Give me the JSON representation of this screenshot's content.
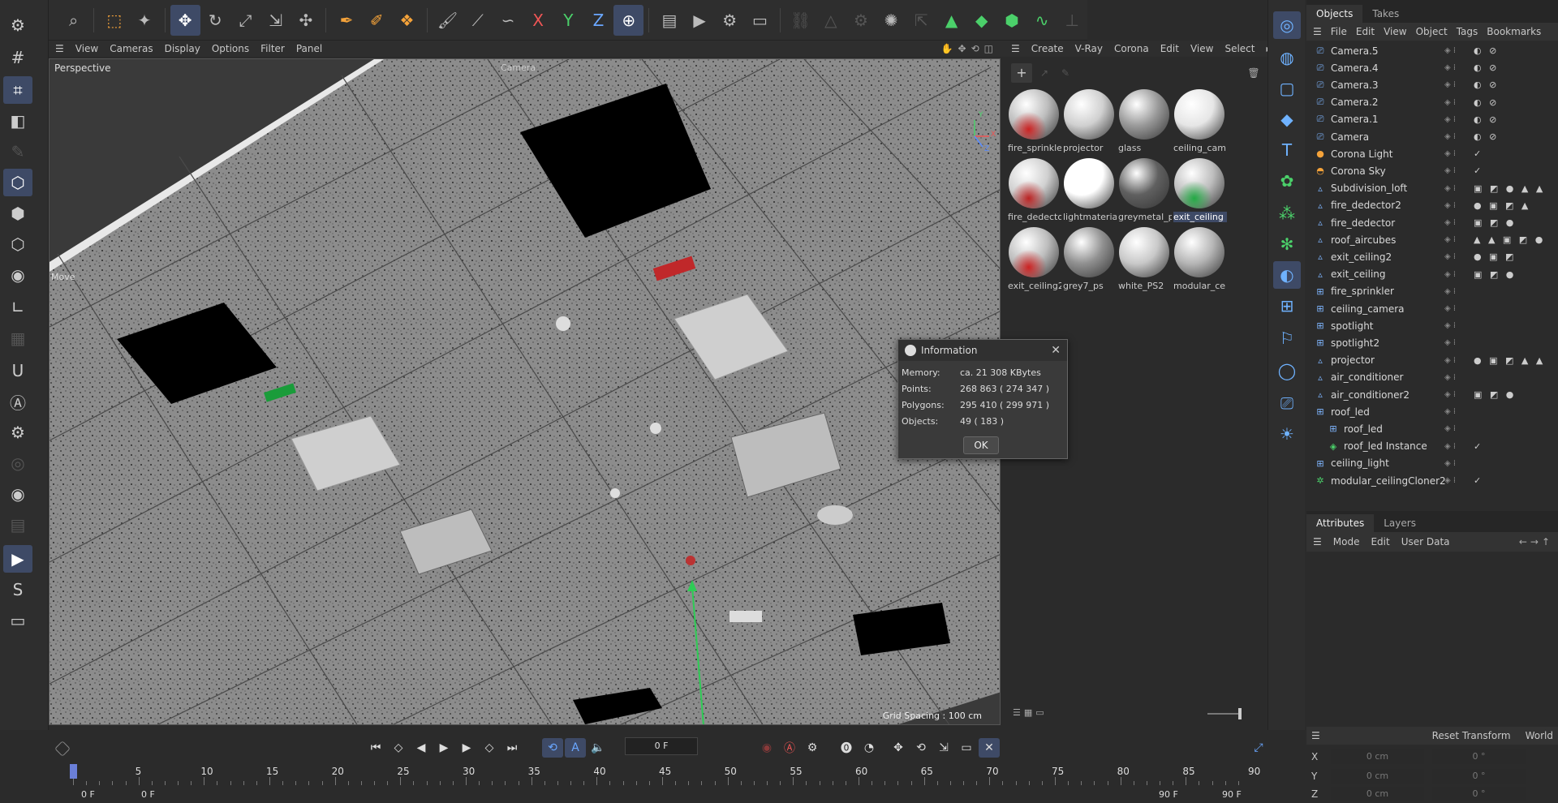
{
  "top_toolbar": {
    "icons": [
      "search-icon",
      "select-icon",
      "live-select-icon",
      "move-icon",
      "rotate-icon",
      "scale-icon",
      "transform-icon",
      "snap-icon",
      "spline-pen-icon",
      "spline-sketch-icon",
      "spline-nodes-icon",
      "brush-icon",
      "knife-icon",
      "magnet-icon",
      "x-axis-icon",
      "y-axis-icon",
      "z-axis-icon",
      "coordinate-system-icon",
      "render-view-icon",
      "render-picture-viewer-icon",
      "edit-render-settings-icon",
      "render-queue-icon",
      "link-icon",
      "triangle-icon",
      "gear-icon",
      "particles-icon",
      "transfer-icon",
      "pyramid-icon",
      "cube-green-icon",
      "cube-icon",
      "deformer-icon",
      "axis-icon"
    ],
    "axis_labels": {
      "x": "X",
      "y": "Y",
      "z": "Z"
    }
  },
  "viewport": {
    "menu": [
      "View",
      "Cameras",
      "Display",
      "Options",
      "Filter",
      "Panel"
    ],
    "label": "Perspective",
    "camera_label": "Camera",
    "grid_spacing": "Grid Spacing : 100 cm",
    "hud_move": "Move",
    "axis": {
      "x": "X",
      "y": "Y",
      "z": "Z"
    }
  },
  "materials": {
    "menu": [
      "Create",
      "V-Ray",
      "Corona",
      "Edit",
      "View",
      "Select"
    ],
    "items": [
      {
        "name": "fire_sprinkle",
        "color": "#bdbdbd",
        "accent": "#cc2222"
      },
      {
        "name": "projector",
        "color": "#d0d0d0",
        "accent": ""
      },
      {
        "name": "glass",
        "color": "#9a9a9a",
        "accent": ""
      },
      {
        "name": "ceiling_cam",
        "color": "#e6e6e6",
        "accent": ""
      },
      {
        "name": "fire_dedecto",
        "color": "#d0d0d0",
        "accent": "#bb2222"
      },
      {
        "name": "lightmateria",
        "color": "#ffffff",
        "accent": ""
      },
      {
        "name": "greymetal_p",
        "color": "#606060",
        "accent": ""
      },
      {
        "name": "exit_ceiling",
        "color": "#bdbdbd",
        "accent": "#22aa44"
      },
      {
        "name": "exit_ceiling2",
        "color": "#bdbdbd",
        "accent": "#cc2222"
      },
      {
        "name": "grey7_ps",
        "color": "#909090",
        "accent": ""
      },
      {
        "name": "white_PS2",
        "color": "#c8c8c8",
        "accent": ""
      },
      {
        "name": "modular_ce",
        "color": "#b5b5b5",
        "accent": ""
      }
    ],
    "selected": "exit_ceiling"
  },
  "objects_panel": {
    "tabs": [
      "Objects",
      "Takes"
    ],
    "menu": [
      "File",
      "Edit",
      "View",
      "Object",
      "Tags",
      "Bookmarks"
    ],
    "rows": [
      {
        "name": "Camera.5",
        "icon": "camera-icon",
        "tags": "◐ ⊘",
        "indent": 0
      },
      {
        "name": "Camera.4",
        "icon": "camera-icon",
        "tags": "◐ ⊘",
        "indent": 0
      },
      {
        "name": "Camera.3",
        "icon": "camera-icon",
        "tags": "◐ ⊘",
        "indent": 0
      },
      {
        "name": "Camera.2",
        "icon": "camera-icon",
        "tags": "◐ ⊘",
        "indent": 0
      },
      {
        "name": "Camera.1",
        "icon": "camera-icon",
        "tags": "◐ ⊘",
        "indent": 0
      },
      {
        "name": "Camera",
        "icon": "camera-icon",
        "tags": "◐ ⊘",
        "indent": 0
      },
      {
        "name": "Corona Light",
        "icon": "light-icon",
        "tags": "✓",
        "indent": 0
      },
      {
        "name": "Corona Sky",
        "icon": "sky-icon",
        "tags": "✓",
        "indent": 0
      },
      {
        "name": "Subdivision_loft",
        "icon": "polygon-icon",
        "tags": "▣ ◩ ● ▲ ▲",
        "indent": 0
      },
      {
        "name": "fire_dedector2",
        "icon": "polygon-icon",
        "tags": "● ▣ ◩ ▲",
        "indent": 0
      },
      {
        "name": "fire_dedector",
        "icon": "polygon-icon",
        "tags": "▣ ◩ ●",
        "indent": 0
      },
      {
        "name": "roof_aircubes",
        "icon": "polygon-icon",
        "tags": "▲ ▲ ▣ ◩ ●",
        "indent": 0
      },
      {
        "name": "exit_ceiling2",
        "icon": "polygon-icon",
        "tags": "● ▣ ◩",
        "indent": 0
      },
      {
        "name": "exit_ceiling",
        "icon": "polygon-icon",
        "tags": "▣ ◩ ●",
        "indent": 0
      },
      {
        "name": "fire_sprinkler",
        "icon": "null-icon",
        "tags": "",
        "indent": 0
      },
      {
        "name": "ceiling_camera",
        "icon": "null-icon",
        "tags": "",
        "indent": 0
      },
      {
        "name": "spotlight",
        "icon": "null-icon",
        "tags": "",
        "indent": 0
      },
      {
        "name": "spotlight2",
        "icon": "null-icon",
        "tags": "",
        "indent": 0
      },
      {
        "name": "projector",
        "icon": "polygon-icon",
        "tags": "● ▣ ◩ ▲ ▲",
        "indent": 0
      },
      {
        "name": "air_conditioner",
        "icon": "polygon-icon",
        "tags": "",
        "indent": 0
      },
      {
        "name": "air_conditioner2",
        "icon": "polygon-icon",
        "tags": "▣ ◩ ●",
        "indent": 0
      },
      {
        "name": "roof_led",
        "icon": "null-icon",
        "tags": "",
        "indent": 0
      },
      {
        "name": "roof_led",
        "icon": "null-icon",
        "tags": "",
        "indent": 1
      },
      {
        "name": "roof_led Instance",
        "icon": "instance-icon",
        "tags": "✓",
        "indent": 1
      },
      {
        "name": "ceiling_light",
        "icon": "null-icon",
        "tags": "",
        "indent": 0
      },
      {
        "name": "modular_ceilingCloner2",
        "icon": "cloner-icon",
        "tags": "✓",
        "indent": 0
      }
    ]
  },
  "attributes_panel": {
    "tabs": [
      "Attributes",
      "Layers"
    ],
    "menu": [
      "Mode",
      "Edit",
      "User Data"
    ],
    "coord_menu": [
      "Reset Transform",
      "World"
    ],
    "coords": [
      {
        "axis": "X",
        "pos": "0 cm",
        "rot": "0 °"
      },
      {
        "axis": "Y",
        "pos": "0 cm",
        "rot": "0 °"
      },
      {
        "axis": "Z",
        "pos": "0 cm",
        "rot": "0 °"
      }
    ]
  },
  "info_dialog": {
    "title": "Information",
    "rows": [
      {
        "label": "Memory:",
        "value": "ca. 21 308 KBytes"
      },
      {
        "label": "Points:",
        "value": "268 863 ( 274 347 )"
      },
      {
        "label": "Polygons:",
        "value": "295 410 ( 299 971 )"
      },
      {
        "label": "Objects:",
        "value": "49 ( 183 )"
      }
    ],
    "ok_label": "OK"
  },
  "timeline": {
    "current_frame": "0 F",
    "ticks": [
      "0",
      "5",
      "10",
      "15",
      "20",
      "25",
      "30",
      "35",
      "40",
      "45",
      "50",
      "55",
      "60",
      "65",
      "70",
      "75",
      "80",
      "85",
      "90"
    ],
    "start_field": "0 F",
    "start_label": "0 F",
    "end_label": "90 F",
    "end_field": "90 F"
  }
}
